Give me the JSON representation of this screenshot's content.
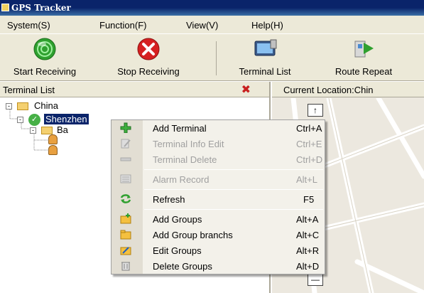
{
  "window": {
    "title": "GPS Tracker"
  },
  "menubar": {
    "items": [
      "System(S)",
      "Function(F)",
      "View(V)",
      "Help(H)"
    ]
  },
  "toolbar": {
    "buttons": [
      "Start Receiving",
      "Stop Receiving",
      "Terminal List",
      "Route Repeat"
    ]
  },
  "left_panel": {
    "title": "Terminal List",
    "close": "✖"
  },
  "right_panel": {
    "title": "Current Location:Chin"
  },
  "tree": {
    "root": "China",
    "city": "Shenzhen",
    "group_partial": "Ba"
  },
  "map": {
    "zoom_in": "↑",
    "zoom_out": "—"
  },
  "context_menu": {
    "items": [
      {
        "label": "Add Terminal",
        "shortcut": "Ctrl+A",
        "enabled": true,
        "icon": "add-icon"
      },
      {
        "label": "Terminal Info Edit",
        "shortcut": "Ctrl+E",
        "enabled": false,
        "icon": "edit-icon"
      },
      {
        "label": "Terminal Delete",
        "shortcut": "Ctrl+D",
        "enabled": false,
        "icon": "delete-icon"
      },
      {
        "label": "Alarm Record",
        "shortcut": "Alt+L",
        "enabled": false,
        "icon": "alarm-record-icon"
      },
      {
        "label": "Refresh",
        "shortcut": "F5",
        "enabled": true,
        "icon": "refresh-icon"
      },
      {
        "label": "Add Groups",
        "shortcut": "Alt+A",
        "enabled": true,
        "icon": "add-folder-icon"
      },
      {
        "label": "Add Group branchs",
        "shortcut": "Alt+C",
        "enabled": true,
        "icon": "folder-icon"
      },
      {
        "label": "Edit Groups",
        "shortcut": "Alt+R",
        "enabled": true,
        "icon": "edit-folder-icon"
      },
      {
        "label": "Delete Groups",
        "shortcut": "Alt+D",
        "enabled": true,
        "icon": "trash-icon"
      }
    ]
  },
  "colors": {
    "titlebar": "#0a246a",
    "chrome": "#ece9d8",
    "selection": "#0a246a",
    "menu_bg": "#f3f1ea"
  }
}
